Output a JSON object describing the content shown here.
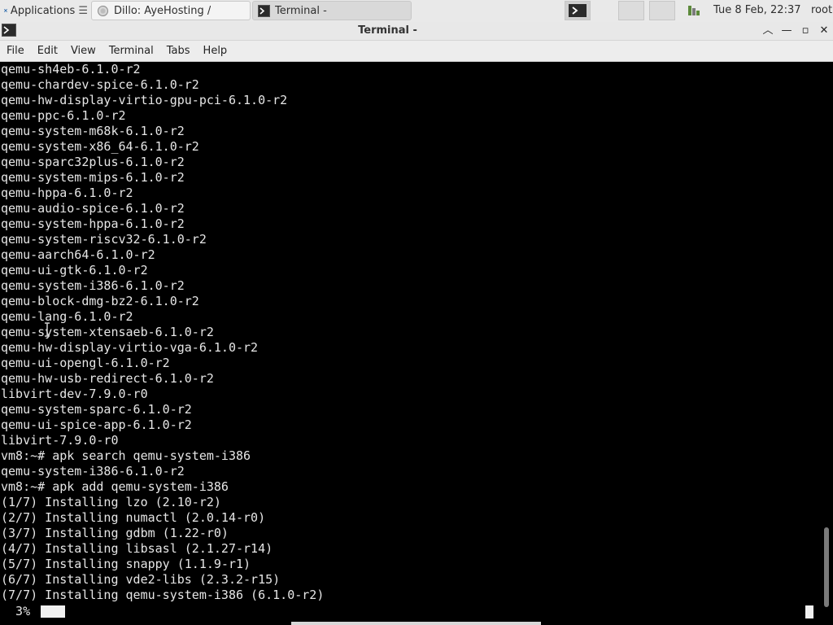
{
  "taskbar": {
    "apps_label": "Applications",
    "apps_icon": "xfce-mouse-icon",
    "tasks": [
      {
        "label": "Dillo: AyeHosting /",
        "icon": "dillo-globe-icon"
      },
      {
        "label": "Terminal -",
        "icon": "terminal-icon"
      }
    ],
    "clock": "Tue  8 Feb, 22:37",
    "user": "root"
  },
  "window": {
    "title": "Terminal -",
    "controls": [
      "roll-up",
      "minimize",
      "maximize",
      "close"
    ]
  },
  "menubar": {
    "items": [
      "File",
      "Edit",
      "View",
      "Terminal",
      "Tabs",
      "Help"
    ]
  },
  "terminal": {
    "lines": [
      "qemu-sh4eb-6.1.0-r2",
      "qemu-chardev-spice-6.1.0-r2",
      "qemu-hw-display-virtio-gpu-pci-6.1.0-r2",
      "qemu-ppc-6.1.0-r2",
      "qemu-system-m68k-6.1.0-r2",
      "qemu-system-x86_64-6.1.0-r2",
      "qemu-sparc32plus-6.1.0-r2",
      "qemu-system-mips-6.1.0-r2",
      "qemu-hppa-6.1.0-r2",
      "qemu-audio-spice-6.1.0-r2",
      "qemu-system-hppa-6.1.0-r2",
      "qemu-system-riscv32-6.1.0-r2",
      "qemu-aarch64-6.1.0-r2",
      "qemu-ui-gtk-6.1.0-r2",
      "qemu-system-i386-6.1.0-r2",
      "qemu-block-dmg-bz2-6.1.0-r2",
      "qemu-lang-6.1.0-r2",
      "qemu-system-xtensaeb-6.1.0-r2",
      "qemu-hw-display-virtio-vga-6.1.0-r2",
      "qemu-ui-opengl-6.1.0-r2",
      "qemu-hw-usb-redirect-6.1.0-r2",
      "libvirt-dev-7.9.0-r0",
      "qemu-system-sparc-6.1.0-r2",
      "qemu-ui-spice-app-6.1.0-r2",
      "libvirt-7.9.0-r0",
      "vm8:~# apk search qemu-system-i386",
      "qemu-system-i386-6.1.0-r2",
      "vm8:~# apk add qemu-system-i386",
      "(1/7) Installing lzo (2.10-r2)",
      "(2/7) Installing numactl (2.0.14-r0)",
      "(3/7) Installing gdbm (1.22-r0)",
      "(4/7) Installing libsasl (2.1.27-r14)",
      "(5/7) Installing snappy (1.1.9-r1)",
      "(6/7) Installing vde2-libs (2.3.2-r15)",
      "(7/7) Installing qemu-system-i386 (6.1.0-r2)"
    ],
    "progress_text": "  3%",
    "progress_value": 3
  },
  "colors": {
    "terminal_bg": "#000000",
    "terminal_fg": "#e6e6e6",
    "chrome_bg": "#e9e9e9"
  }
}
